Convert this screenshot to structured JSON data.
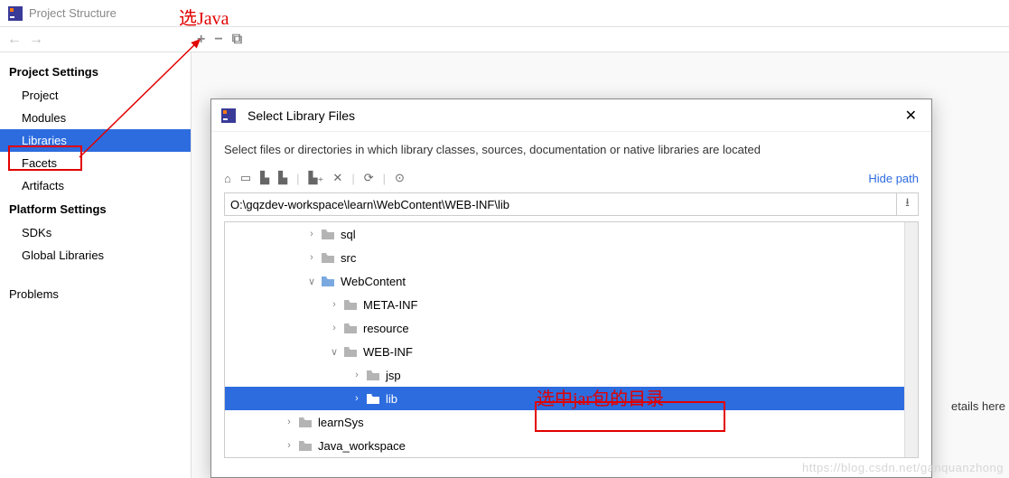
{
  "titlebar": {
    "title": "Project Structure"
  },
  "toolbar": {
    "add": "+",
    "remove": "−",
    "copy": "⧉"
  },
  "sidebar": {
    "heading_project": "Project Settings",
    "items_project": [
      "Project",
      "Modules",
      "Libraries",
      "Facets",
      "Artifacts"
    ],
    "heading_platform": "Platform Settings",
    "items_platform": [
      "SDKs",
      "Global Libraries"
    ],
    "problems": "Problems"
  },
  "details_hint": "etails here",
  "modal": {
    "title": "Select Library Files",
    "instruction": "Select files or directories in which library classes, sources, documentation or native libraries are located",
    "hide_path": "Hide path",
    "path": "O:\\gqzdev-workspace\\learn\\WebContent\\WEB-INF\\lib",
    "tree": [
      {
        "label": "sql",
        "level": 3,
        "expanded": false,
        "chev": true
      },
      {
        "label": "src",
        "level": 3,
        "expanded": false,
        "chev": true
      },
      {
        "label": "WebContent",
        "level": 3,
        "expanded": true,
        "chev": true,
        "web": true
      },
      {
        "label": "META-INF",
        "level": 4,
        "expanded": false,
        "chev": true
      },
      {
        "label": "resource",
        "level": 4,
        "expanded": false,
        "chev": true
      },
      {
        "label": "WEB-INF",
        "level": 4,
        "expanded": true,
        "chev": true
      },
      {
        "label": "jsp",
        "level": 5,
        "expanded": false,
        "chev": true
      },
      {
        "label": "lib",
        "level": 5,
        "expanded": false,
        "chev": true,
        "selected": true
      },
      {
        "label": "learnSys",
        "level": 2,
        "expanded": false,
        "chev": true
      },
      {
        "label": "Java_workspace",
        "level": 2,
        "expanded": false,
        "chev": true
      }
    ]
  },
  "annotations": {
    "top": "选Java",
    "mid": "选中jar包的目录"
  },
  "watermark": "https://blog.csdn.net/ganquanzhong"
}
